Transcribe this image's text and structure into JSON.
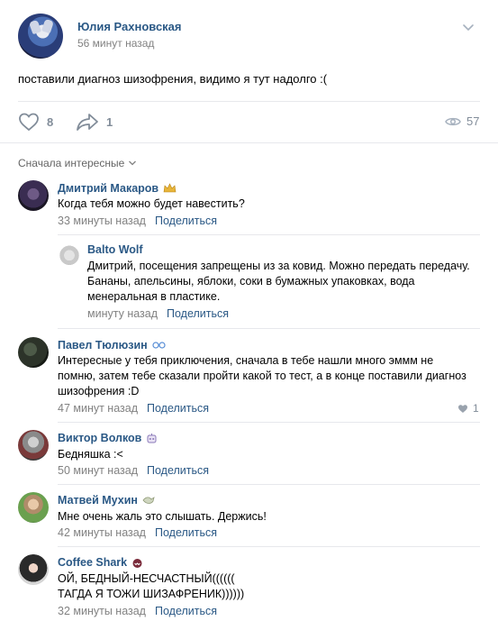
{
  "post": {
    "author": "Юлия Рахновская",
    "time": "56 минут назад",
    "text": "поставили диагноз шизофрения, видимо я тут надолго :(",
    "likes": "8",
    "shares": "1",
    "views": "57",
    "menu_icon": "chevron-down-icon"
  },
  "comments_header": {
    "sort_label": "Сначала интересные"
  },
  "share_label": "Поделиться",
  "comments": [
    {
      "name": "Дмитрий Макаров",
      "badge": "crown",
      "text": "Когда тебя можно будет навестить?",
      "time": "33 минуты назад"
    },
    {
      "name": "Balto Wolf",
      "text": "Дмитрий, посещения запрещены из за ковид. Можно передать передачу. Бананы, апельсины, яблоки, соки в бумажных упаковках, вода менеральная в пластике.",
      "time": "минуту назад"
    },
    {
      "name": "Павел Тюлюзин",
      "badge": "glasses",
      "text": "Интересные у тебя приключения, сначала в тебе нашли много эммм не помню, затем тебе сказали пройти какой то тест, а в конце поставили диагноз шизофрения :D",
      "time": "47 минут назад",
      "likes": "1"
    },
    {
      "name": "Виктор Волков",
      "badge": "robot",
      "text": "Бедняшка :<",
      "time": "50 минут назад"
    },
    {
      "name": "Матвей Мухин",
      "badge": "bird",
      "text": "Мне очень жаль это слышать. Держись!",
      "time": "42 минуты назад"
    },
    {
      "name": "Coffee Shark",
      "badge": "shark",
      "text": "ОЙ, БЕДНЫЙ-НЕСЧАСТНЫЙ((((((\nТАГДА Я ТОЖИ ШИЗАФРЕНИК))))))",
      "time": "32 минуты назад"
    }
  ],
  "colors": {
    "link": "#2a5885",
    "muted": "#828282",
    "icon": "#818c99",
    "divider": "#e7e8ec"
  }
}
